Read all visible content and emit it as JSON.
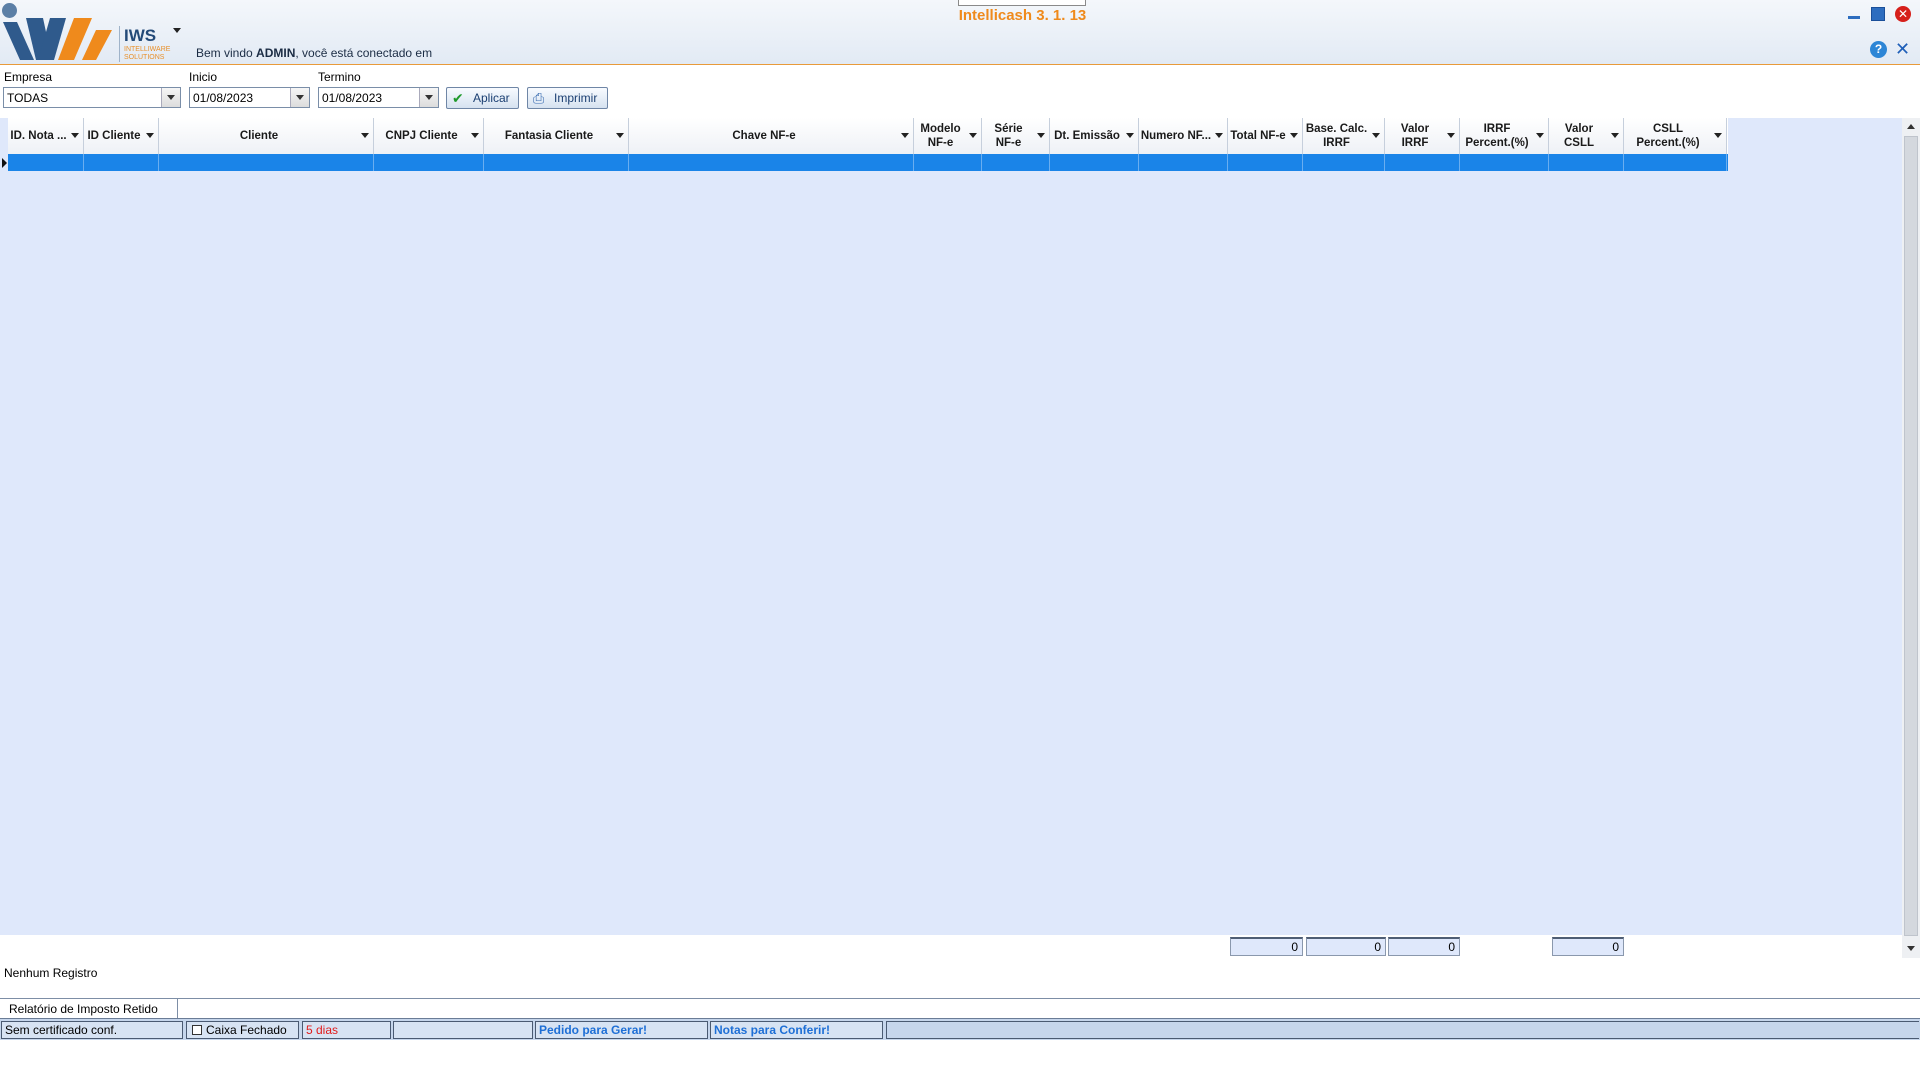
{
  "app": {
    "title": "Intellicash 3. 1. 13",
    "brand": "IWS",
    "brand_sub": "INTELLIWARE SOLUTIONS",
    "welcome_prefix": "Bem vindo ",
    "welcome_user": "ADMIN",
    "welcome_suffix": ", você está conectado em"
  },
  "window_controls": {
    "close_glyph": "✕",
    "help_glyph": "?",
    "x_glyph": "✕"
  },
  "filters": {
    "empresa_label": "Empresa",
    "empresa_value": "TODAS",
    "inicio_label": "Inicio",
    "inicio_value": "01/08/2023",
    "termino_label": "Termino",
    "termino_value": "01/08/2023",
    "apply_label": "Aplicar",
    "print_label": "Imprimir"
  },
  "grid": {
    "columns": [
      "ID. Nota ...",
      "ID Cliente",
      "Cliente",
      "CNPJ Cliente",
      "Fantasia Cliente",
      "Chave NF-e",
      "Modelo\nNF-e",
      "Série\nNF-e",
      "Dt. Emissão",
      "Numero NF...",
      "Total NF-e",
      "Base. Calc.\nIRRF",
      "Valor\nIRRF",
      "IRRF\nPercent.(%)",
      "Valor\nCSLL",
      "CSLL\nPercent.(%)"
    ],
    "totals": {
      "total_nfe": "0",
      "base_calc_irrf": "0",
      "valor_irrf": "0",
      "valor_csll": "0"
    }
  },
  "status_count": "Nenhum Registro",
  "tab_label": "Relatório de Imposto Retido",
  "statusbar": {
    "certificate": "Sem certificado conf.",
    "cash": "Caixa Fechado",
    "days": "5 dias",
    "empty": "",
    "orders": "Pedido para Gerar!",
    "notes": "Notas para Conferir!"
  },
  "colors": {
    "accent_orange": "#ef8a1c",
    "selection_blue": "#1a84e8",
    "grid_bg": "#dfe8fb"
  }
}
